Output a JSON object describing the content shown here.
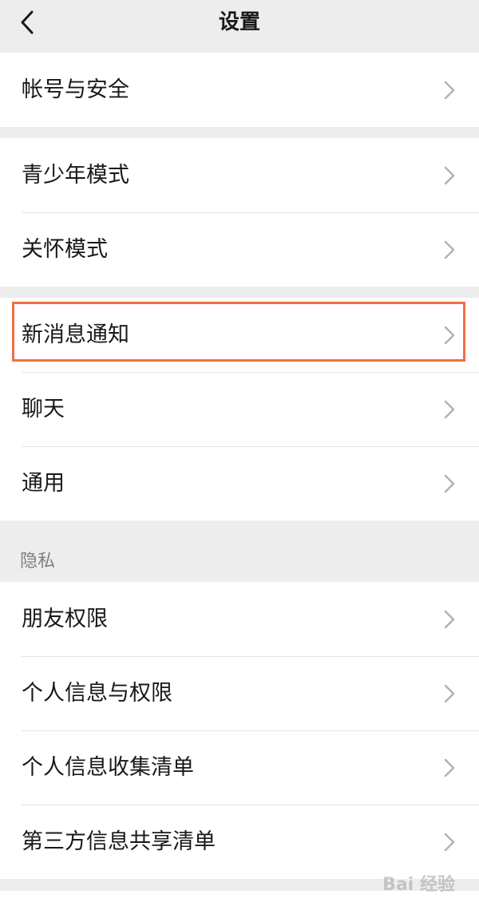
{
  "header": {
    "title": "设置"
  },
  "groups": [
    {
      "items": [
        {
          "label": "帐号与安全"
        }
      ]
    },
    {
      "items": [
        {
          "label": "青少年模式"
        },
        {
          "label": "关怀模式"
        }
      ]
    },
    {
      "items": [
        {
          "label": "新消息通知"
        },
        {
          "label": "聊天"
        },
        {
          "label": "通用"
        }
      ]
    },
    {
      "title": "隐私",
      "items": [
        {
          "label": "朋友权限"
        },
        {
          "label": "个人信息与权限"
        },
        {
          "label": "个人信息收集清单"
        },
        {
          "label": "第三方信息共享清单"
        }
      ]
    }
  ],
  "watermark": "Bai 经验",
  "colors": {
    "background": "#ededed",
    "card": "#ffffff",
    "highlight": "#ef6f45"
  }
}
